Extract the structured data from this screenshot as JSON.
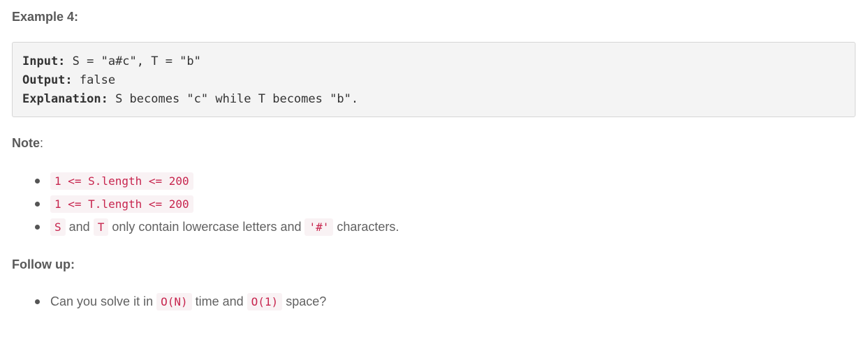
{
  "example": {
    "heading": "Example 4:",
    "input_label": "Input:",
    "input_value": " S = \"a#c\", T = \"b\"",
    "output_label": "Output:",
    "output_value": " false",
    "explanation_label": "Explanation:",
    "explanation_value": " S becomes \"c\" while T becomes \"b\"."
  },
  "note": {
    "heading": "Note",
    "colon": ":",
    "items": [
      {
        "code": "1 <= S.length <= 200"
      },
      {
        "code": "1 <= T.length <= 200"
      },
      {
        "code_s": "S",
        "text_and": " and ",
        "code_t": "T",
        "text_mid": " only contain lowercase letters and ",
        "code_hash": "'#'",
        "text_end": " characters."
      }
    ]
  },
  "follow_up": {
    "heading": "Follow up:",
    "items": [
      {
        "text_start": "Can you solve it in ",
        "code_time": "O(N)",
        "text_mid": " time and ",
        "code_space": "O(1)",
        "text_end": " space?"
      }
    ]
  },
  "colors": {
    "code_text": "#c7254e",
    "code_background": "#f9f2f4",
    "pre_background": "#f4f4f4",
    "body_text": "#616161"
  }
}
